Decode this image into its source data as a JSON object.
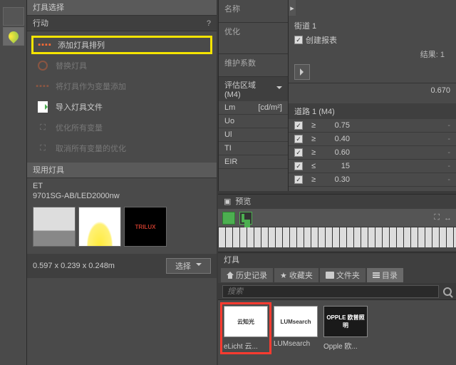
{
  "left_panel": {
    "title": "灯具选择",
    "actions_header": "行动",
    "actions": [
      {
        "label": "添加灯具排列",
        "icon": "dots",
        "highlighted": true,
        "enabled": true
      },
      {
        "label": "替换灯具",
        "icon": "swap",
        "enabled": false
      },
      {
        "label": "将灯具作为变量添加",
        "icon": "dots",
        "enabled": false
      },
      {
        "label": "导入灯具文件",
        "icon": "import",
        "enabled": true
      },
      {
        "label": "优化所有变量",
        "icon": "opt",
        "enabled": false
      },
      {
        "label": "取消所有变量的优化",
        "icon": "opt",
        "enabled": false
      }
    ],
    "used_header": "现用灯具",
    "product": {
      "line1": "ET",
      "line2": "9701SG-AB/LED2000nw",
      "dimensions": "0.597 x 0.239 x 0.248m",
      "select_btn": "选择"
    },
    "thumb3_text": "TRILUX"
  },
  "mid_panel": {
    "name_label": "名称",
    "optimize_label": "优化",
    "maintenance_label": "维护系数",
    "eval_header": "评估区域 (M4)",
    "metrics": [
      {
        "k": "Lm",
        "u": "[cd/m²]"
      },
      {
        "k": "Uo",
        "u": ""
      },
      {
        "k": "Ul",
        "u": ""
      },
      {
        "k": "TI",
        "u": ""
      },
      {
        "k": "EIR",
        "u": ""
      }
    ]
  },
  "right_panel": {
    "street": "街道 1",
    "create_report": "创建报表",
    "result_label": "结果: 1",
    "maint_value": "0.670",
    "road_header": "道路 1 (M4)",
    "criteria": [
      {
        "op": "≥",
        "val": "0.75",
        "dash": "-"
      },
      {
        "op": "≥",
        "val": "0.40",
        "dash": "-"
      },
      {
        "op": "≥",
        "val": "0.60",
        "dash": "-"
      },
      {
        "op": "≤",
        "val": "15",
        "dash": "-"
      },
      {
        "op": "≥",
        "val": "0.30",
        "dash": "-"
      }
    ]
  },
  "preview": {
    "header": "预览"
  },
  "fixture_panel": {
    "header": "灯具",
    "tabs": [
      {
        "label": "历史记录",
        "icon": "home"
      },
      {
        "label": "收藏夹",
        "icon": "star"
      },
      {
        "label": "文件夹",
        "icon": "folder"
      },
      {
        "label": "目录",
        "icon": "list",
        "active": true
      }
    ],
    "search_placeholder": "搜索",
    "catalog": [
      {
        "label": "eLicht 云...",
        "thumb": "云知光",
        "highlighted": true
      },
      {
        "label": "LUMsearch",
        "thumb": "LUMsearch"
      },
      {
        "label": "Opple 欧...",
        "thumb": "OPPLE\n欧普照明"
      }
    ]
  }
}
